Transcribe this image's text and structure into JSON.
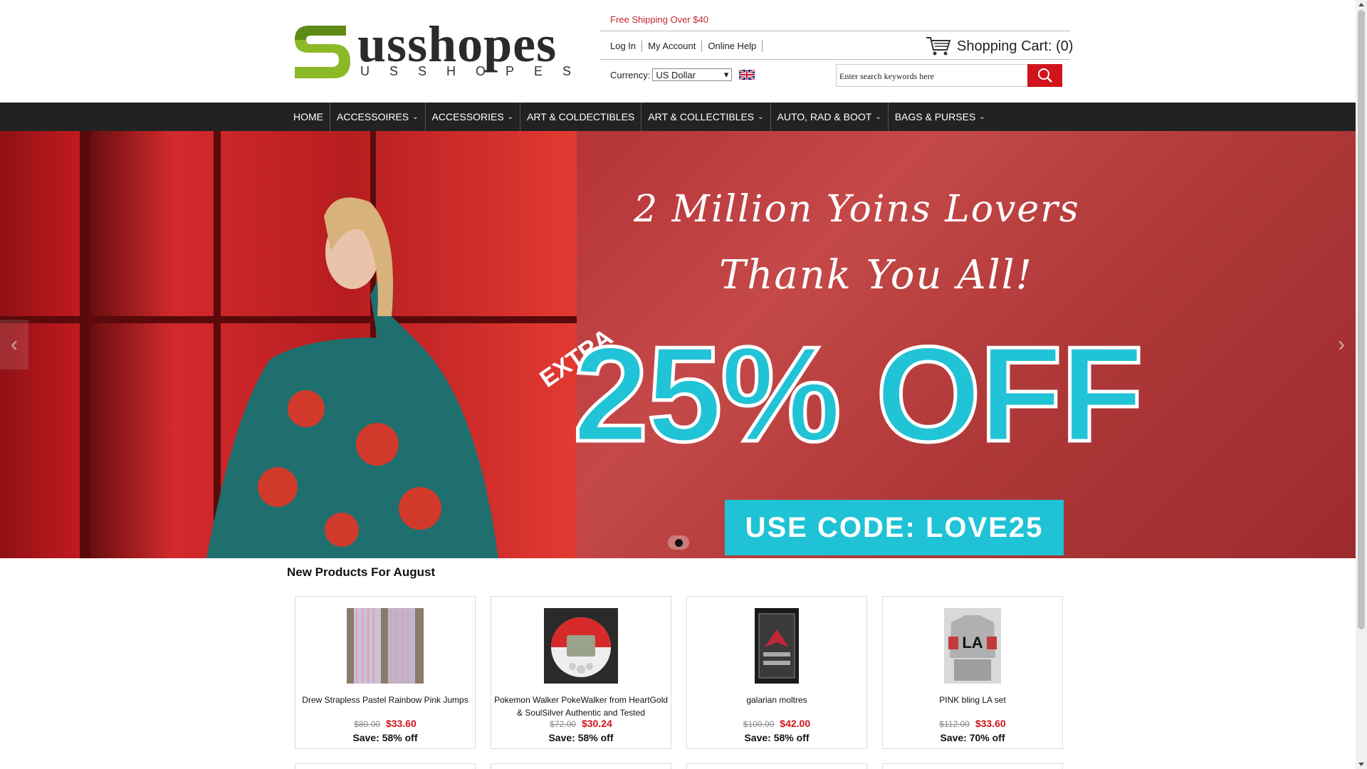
{
  "header": {
    "brand": "usshopes",
    "brand_sub": "USSHOPES",
    "free_shipping": "Free Shipping Over $40",
    "links": [
      "Log In",
      "My Account",
      "Online Help"
    ],
    "cart_label": "Shopping Cart: (0)",
    "currency_label": "Currency:",
    "currency_value": "US Dollar",
    "search_placeholder": "Enter search keywords here"
  },
  "nav": {
    "items": [
      {
        "label": "HOME",
        "dropdown": false
      },
      {
        "label": "ACCESSOIRES",
        "dropdown": true
      },
      {
        "label": "ACCESSORIES",
        "dropdown": true
      },
      {
        "label": "ART & COLDECTIBLES",
        "dropdown": false
      },
      {
        "label": "ART & COLLECTIBLES",
        "dropdown": true
      },
      {
        "label": "AUTO, RAD & BOOT",
        "dropdown": true
      },
      {
        "label": "BAGS & PURSES",
        "dropdown": true
      }
    ]
  },
  "banner": {
    "headline1": "2 Million Yoins Lovers",
    "headline2": "Thank You All!",
    "extra": "EXTRA",
    "discount": "25% OFF",
    "code": "USE CODE: LOVE25"
  },
  "products": {
    "title": "New Products For August",
    "items": [
      {
        "name": "Drew Strapless Pastel Rainbow Pink Jumps",
        "old_price": "$80.00",
        "price": "$33.60",
        "save": "Save: 58% off"
      },
      {
        "name": "Pokemon Walker PokeWalker from HeartGold & SoulSilver Authentic and Tested",
        "old_price": "$72.00",
        "price": "$30.24",
        "save": "Save: 58% off"
      },
      {
        "name": "galarian moltres",
        "old_price": "$100.00",
        "price": "$42.00",
        "save": "Save: 58% off"
      },
      {
        "name": "PINK bling LA set",
        "old_price": "$112.00",
        "price": "$33.60",
        "save": "Save: 70% off"
      }
    ]
  },
  "colors": {
    "accent": "#d1141b",
    "nav_bg": "#222222",
    "promo_cyan": "#21c3d6",
    "logo_green": "#8cb927"
  }
}
